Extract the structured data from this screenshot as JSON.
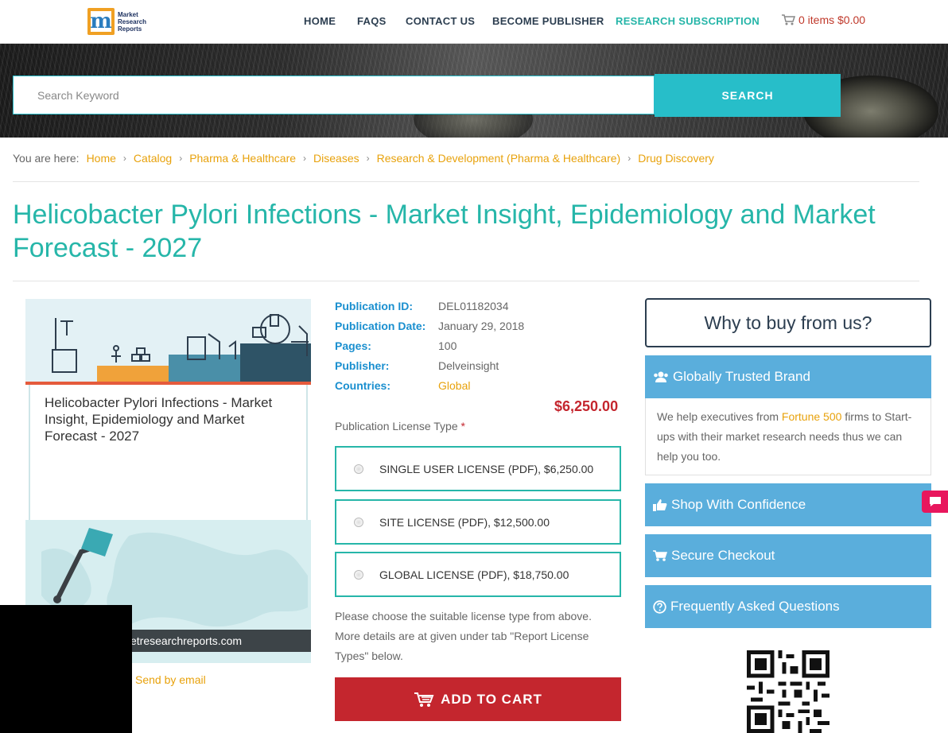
{
  "header": {
    "logo_text": "Market Research Reports",
    "nav": [
      "HOME",
      "FAQS",
      "CONTACT US",
      "BECOME PUBLISHER",
      "RESEARCH SUBSCRIPTION"
    ],
    "cart": "0 items $0.00"
  },
  "search": {
    "placeholder": "Search Keyword",
    "button": "SEARCH"
  },
  "breadcrumb": {
    "lead": "You are here:",
    "items": [
      "Home",
      "Catalog",
      "Pharma & Healthcare",
      "Diseases",
      "Research & Development (Pharma & Healthcare)",
      "Drug Discovery"
    ]
  },
  "title": "Helicobacter Pylori Infections - Market Insight, Epidemiology and Market Forecast - 2027",
  "cover": {
    "title": "Helicobacter Pylori Infections - Market Insight, Epidemiology and Market Forecast - 2027",
    "url": "etresearchreports.com",
    "send_email": "Send by email"
  },
  "details": [
    {
      "label": "Publication ID:",
      "value": "DEL01182034"
    },
    {
      "label": "Publication Date:",
      "value": "January 29, 2018"
    },
    {
      "label": "Pages:",
      "value": "100"
    },
    {
      "label": "Publisher:",
      "value": "Delveinsight"
    },
    {
      "label": "Countries:",
      "value": "Global"
    }
  ],
  "price": "$6,250.00",
  "license": {
    "label": "Publication License Type",
    "required": "*",
    "options": [
      "SINGLE USER LICENSE (PDF), $6,250.00",
      "SITE LICENSE (PDF), $12,500.00",
      "GLOBAL LICENSE (PDF), $18,750.00"
    ],
    "note": "Please choose the suitable license type from above. More details are at given under tab \"Report License Types\" below."
  },
  "add_to_cart": "ADD TO CART",
  "sidebar": {
    "why": "Why to buy from us?",
    "brand_head": "Globally Trusted Brand",
    "brand_body_1": "We help executives from ",
    "brand_body_hl": "Fortune 500",
    "brand_body_2": " firms to Start-ups with their market research needs thus we can help you too.",
    "shop": "Shop With Confidence",
    "secure": "Secure Checkout",
    "faq": "Frequently Asked Questions"
  },
  "colors": {
    "teal": "#26b6a9",
    "orange": "#e8a20c",
    "blue_label": "#1a8fcf",
    "red": "#c4262e",
    "sidebar_blue": "#5aaedc"
  }
}
